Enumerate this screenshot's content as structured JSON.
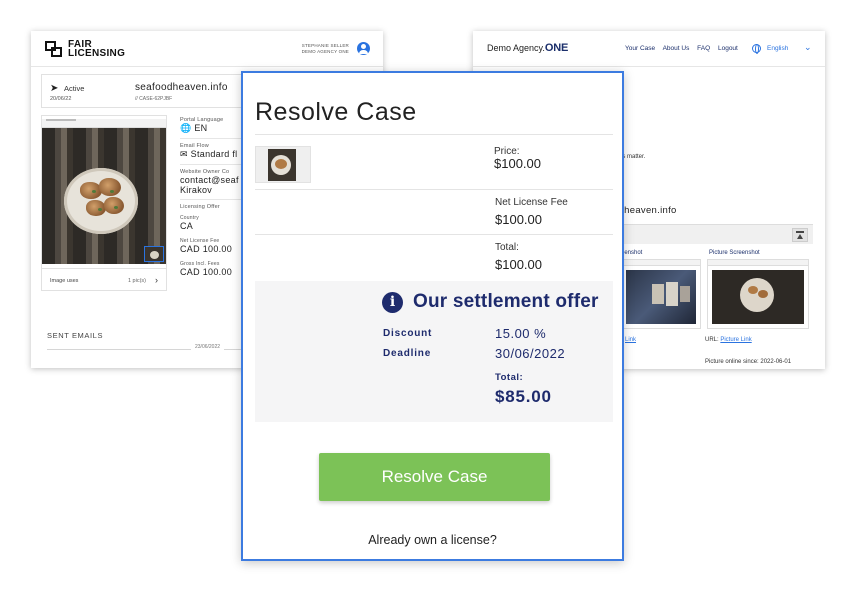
{
  "left_window": {
    "logo_line1": "FAIR",
    "logo_line2": "LICENSING",
    "user_name": "STEPHANIE SELLER",
    "user_org": "DEMO AGENCY ONE",
    "case": {
      "status": "Active",
      "date": "20/06/22",
      "domain": "seafoodheaven.info",
      "case_id": "// CASE-62PJBF"
    },
    "image_card": {
      "uses_label": "Image uses",
      "uses_count": "1 pic(s)"
    },
    "info": {
      "portal_language_label": "Portal Language",
      "portal_language_value": "EN",
      "email_flow_label": "Email Flow",
      "email_flow_value": "Standard fl",
      "owner_contact_label": "Website Owner Co",
      "owner_contact_value1": "contact@seaf",
      "owner_contact_value2": "Kirakov",
      "licensing_offer_label": "Licensing Offer",
      "country_label": "Country",
      "country_value": "CA",
      "net_fee_label": "Net License Fee",
      "net_fee_value": "CAD 100.00",
      "gross_fee_label": "Gross Incl. Fees",
      "gross_fee_value": "CAD 100.00"
    },
    "sent_emails_label": "SENT EMAILS",
    "timeline_date": "23/06/2022"
  },
  "right_window": {
    "logo_prefix": "Demo Agency.",
    "logo_suffix": "ONE",
    "nav": [
      "Your Case",
      "About Us",
      "FAQ",
      "Logout"
    ],
    "language": "English",
    "fragment_dot": ".",
    "fragment_matter": "is matter.",
    "domain_fragment": "odheaven.info",
    "screenshot1_title": "eenshot",
    "screenshot2_title": "Picture Screenshot",
    "link1_fragment": "Link",
    "url_label": "URL:",
    "url_link": "Picture Link",
    "online_since": "Picture online since: 2022-06-01"
  },
  "resolve_case": {
    "title": "Resolve Case",
    "price_label": "Price:",
    "price_value": "$100.00",
    "net_fee_label": "Net License Fee",
    "net_fee_value": "$100.00",
    "total_label": "Total:",
    "total_value": "$100.00",
    "offer": {
      "title": "Our settlement offer",
      "discount_label": "Discount",
      "discount_value": "15.00 %",
      "deadline_label": "Deadline",
      "deadline_value": "30/06/2022",
      "total_label": "Total:",
      "total_value": "$85.00"
    },
    "button_label": "Resolve Case",
    "license_link": "Already own a license?"
  },
  "colors": {
    "accent_blue": "#3c7be0",
    "navy": "#1e2b6d",
    "button_green": "#7cc257"
  }
}
